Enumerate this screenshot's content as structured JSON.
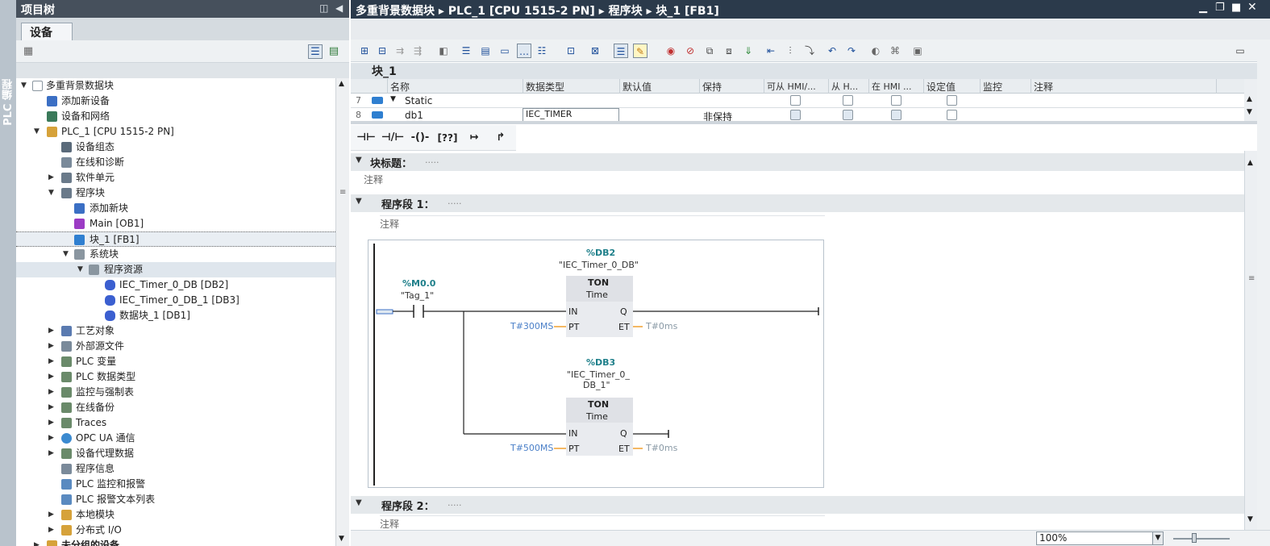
{
  "side_strip": {
    "label": "PLC 编程"
  },
  "tree": {
    "title": "项目树",
    "tab": "设备",
    "items": [
      {
        "label": "多重背景数据块",
        "expanded": true
      },
      {
        "label": "添加新设备"
      },
      {
        "label": "设备和网络"
      },
      {
        "label": "PLC_1 [CPU 1515-2 PN]",
        "expanded": true
      },
      {
        "label": "设备组态"
      },
      {
        "label": "在线和诊断"
      },
      {
        "label": "软件单元",
        "expanded": false
      },
      {
        "label": "程序块",
        "expanded": true
      },
      {
        "label": "添加新块"
      },
      {
        "label": "Main [OB1]"
      },
      {
        "label": "块_1 [FB1]",
        "selected": true
      },
      {
        "label": "系统块",
        "expanded": true
      },
      {
        "label": "程序资源",
        "expanded": true
      },
      {
        "label": "IEC_Timer_0_DB [DB2]"
      },
      {
        "label": "IEC_Timer_0_DB_1 [DB3]"
      },
      {
        "label": "数据块_1 [DB1]"
      },
      {
        "label": "工艺对象",
        "expanded": false
      },
      {
        "label": "外部源文件",
        "expanded": false
      },
      {
        "label": "PLC 变量",
        "expanded": false
      },
      {
        "label": "PLC 数据类型",
        "expanded": false
      },
      {
        "label": "监控与强制表",
        "expanded": false
      },
      {
        "label": "在线备份",
        "expanded": false
      },
      {
        "label": "Traces",
        "expanded": false
      },
      {
        "label": "OPC UA 通信",
        "expanded": false
      },
      {
        "label": "设备代理数据",
        "expanded": false
      },
      {
        "label": "程序信息"
      },
      {
        "label": "PLC 监控和报警"
      },
      {
        "label": "PLC 报警文本列表"
      },
      {
        "label": "本地模块",
        "expanded": false
      },
      {
        "label": "分布式 I/O",
        "expanded": false
      },
      {
        "label": "未分组的设备",
        "expanded": false
      }
    ]
  },
  "main": {
    "breadcrumb": "多重背景数据块 ▸ PLC_1 [CPU 1515-2 PN] ▸ 程序块 ▸ 块_1 [FB1]",
    "block_name": "块_1",
    "interface": {
      "columns": [
        "名称",
        "数据类型",
        "默认值",
        "保持",
        "可从 HMI/...",
        "从 H...",
        "在 HMI ...",
        "设定值",
        "监控",
        "注释"
      ],
      "rows": [
        {
          "num": "7",
          "name": "Static",
          "type": "",
          "retain": ""
        },
        {
          "num": "8",
          "name": "db1",
          "type": "IEC_TIMER",
          "retain": "非保持"
        }
      ]
    },
    "block_title": {
      "label": "块标题：",
      "dots": ".....",
      "comment": "注释"
    },
    "networks": [
      {
        "label": "程序段 1：",
        "dots": ".....",
        "comment": "注释"
      },
      {
        "label": "程序段 2：",
        "dots": ".....",
        "comment": "注释"
      }
    ],
    "ladder": {
      "contact": {
        "address": "%M0.0",
        "name": "\"Tag_1\""
      },
      "timer1": {
        "db": "%DB2",
        "db_name": "\"IEC_Timer_0_DB\"",
        "type": "TON",
        "type2": "Time",
        "pt": "T#300MS",
        "et": "T#0ms"
      },
      "timer2": {
        "db": "%DB3",
        "db_name_1": "\"IEC_Timer_0_",
        "db_name_2": "DB_1\"",
        "type": "TON",
        "type2": "Time",
        "pt": "T#500MS",
        "et": "T#0ms"
      },
      "pins": {
        "in": "IN",
        "pt": "PT",
        "q": "Q",
        "et": "ET"
      }
    },
    "zoom": "100%"
  }
}
